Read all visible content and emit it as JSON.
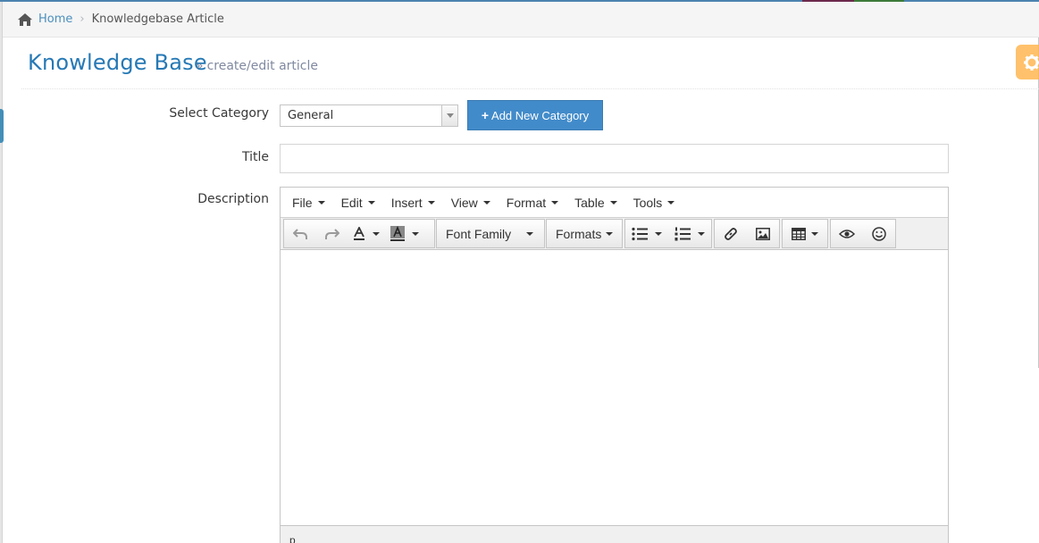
{
  "breadcrumbs": {
    "home_label": "Home",
    "separator": "›",
    "current_label": "Knowledgebase Article"
  },
  "header": {
    "title": "Knowledge Base",
    "subtitle_prefix": "»",
    "subtitle": "create/edit article"
  },
  "form": {
    "category_label": "Select Category",
    "category_value": "General",
    "add_category_label": "Add New Category",
    "title_label": "Title",
    "title_value": "",
    "description_label": "Description"
  },
  "editor": {
    "menus": [
      {
        "label": "File"
      },
      {
        "label": "Edit"
      },
      {
        "label": "Insert"
      },
      {
        "label": "View"
      },
      {
        "label": "Format"
      },
      {
        "label": "Table"
      },
      {
        "label": "Tools"
      }
    ],
    "toolbar": {
      "font_family_label": "Font Family",
      "formats_label": "Formats"
    },
    "status_path": "p"
  },
  "icons": {
    "home": "home-icon",
    "settings": "gear-icon",
    "undo": "undo-icon",
    "redo": "redo-icon",
    "text_color": "text-color-icon",
    "background_color": "background-color-icon",
    "bullet_list": "bullet-list-icon",
    "numbered_list": "numbered-list-icon",
    "link": "link-icon",
    "image": "image-icon",
    "table": "table-icon",
    "preview": "eye-icon",
    "emoticons": "smiley-icon"
  },
  "colors": {
    "accent_blue": "#2679b5",
    "link_blue": "#4c8fbd",
    "button_blue": "#428bca",
    "settings_orange": "#ffb752"
  }
}
